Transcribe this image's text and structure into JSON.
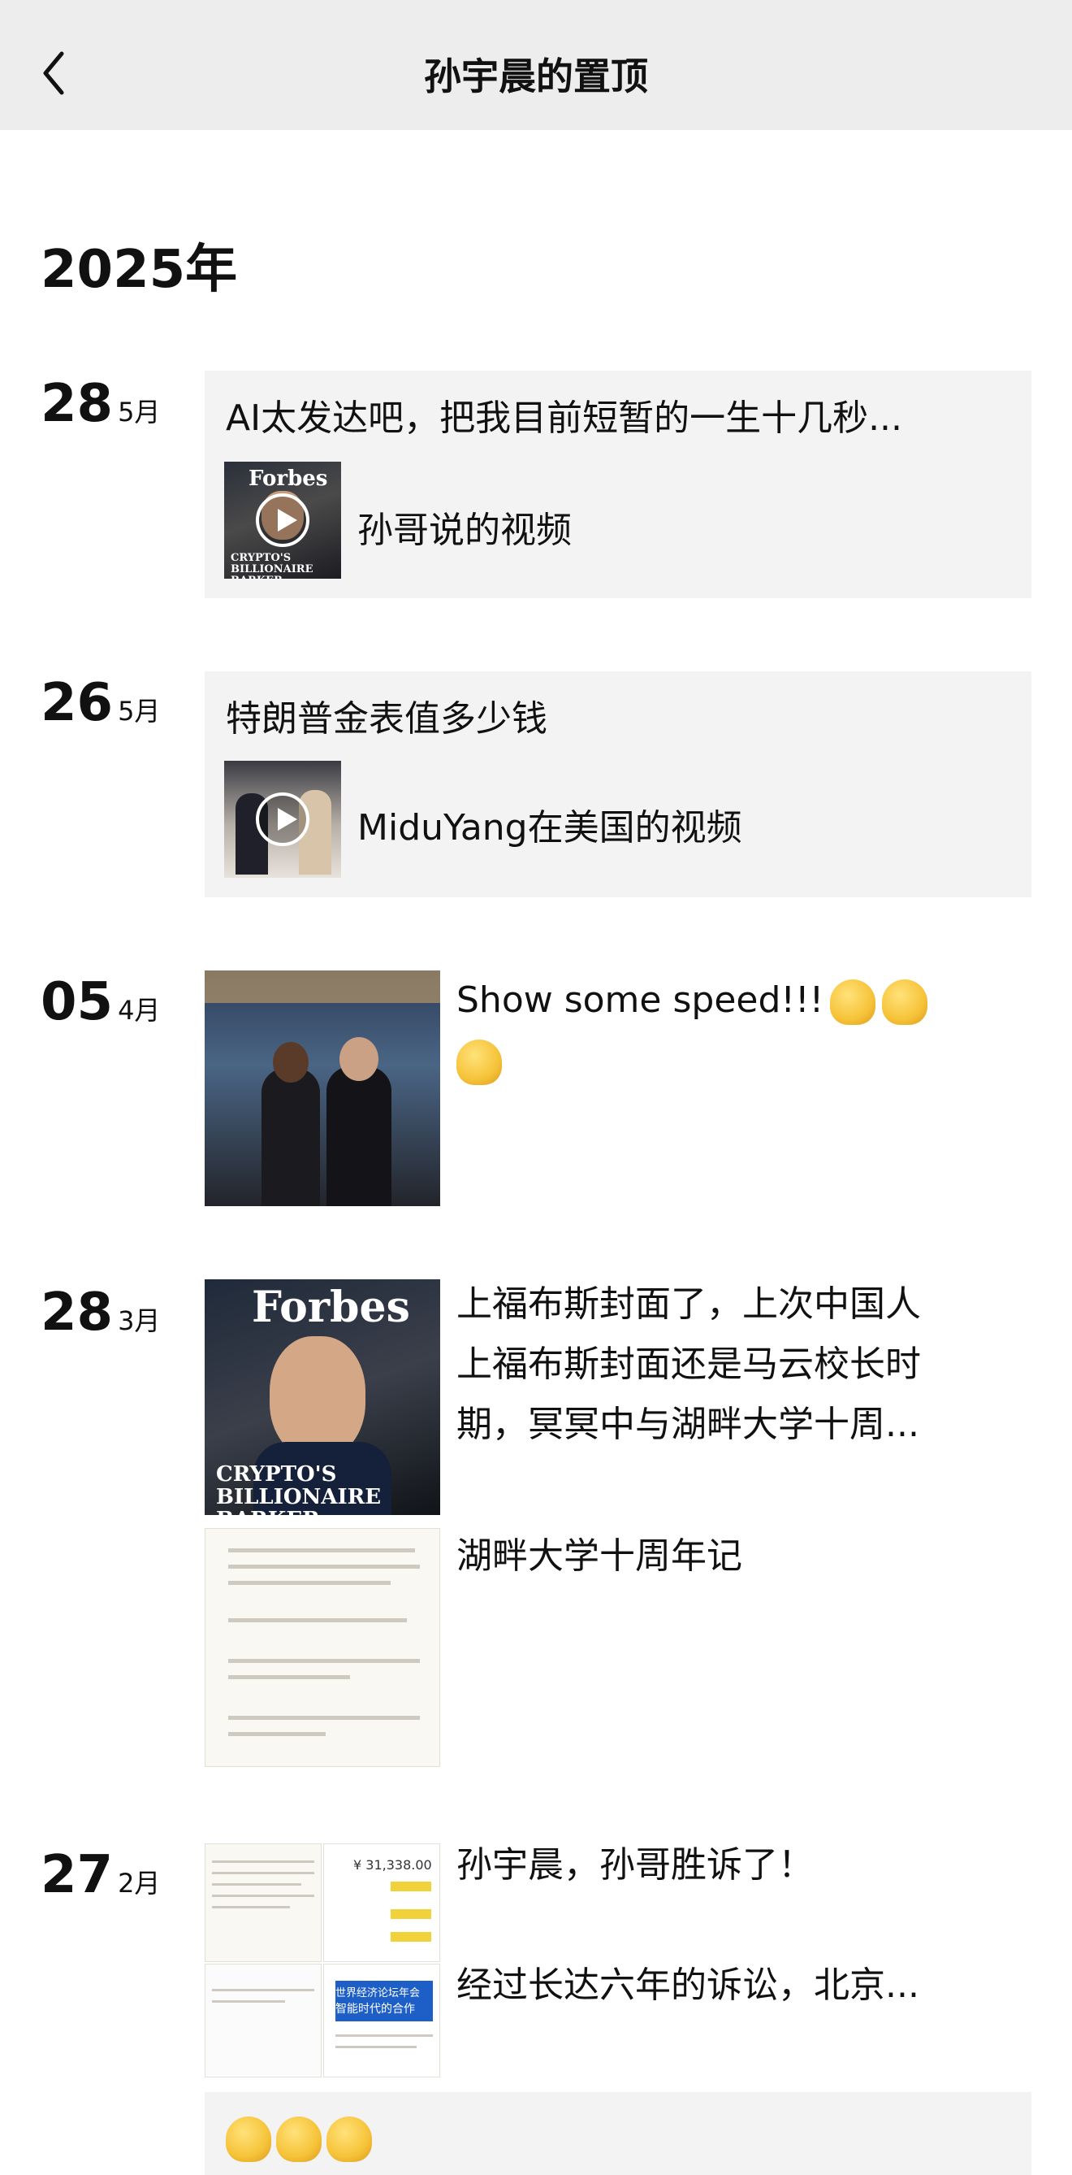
{
  "header": {
    "title": "孙宇晨的置顶"
  },
  "year": "2025年",
  "posts": [
    {
      "day": "28",
      "month": "5月",
      "title": "AI太发达吧，把我目前短暂的一生十几秒...",
      "video_label": "孙哥说的视频",
      "thumb_text": "Forbes",
      "thumb_sub": "CRYPTO'S BILLIONAIRE BARKER"
    },
    {
      "day": "26",
      "month": "5月",
      "title": "特朗普金表值多少钱",
      "video_label": "MiduYang在美国的视频"
    },
    {
      "day": "05",
      "month": "4月",
      "text": "Show some speed!!!"
    },
    {
      "day": "28",
      "month": "3月",
      "text_lines": [
        "上福布斯封面了，上次中国人",
        "上福布斯封面还是马云校长时",
        "期，冥冥中与湖畔大学十周..."
      ],
      "forbes_title": "Forbes",
      "forbes_sub": "CRYPTO'S BILLIONAIRE BARKER",
      "link_title": "湖畔大学十周年记"
    },
    {
      "day": "27",
      "month": "2月",
      "text_lines": [
        "孙宇晨，孙哥胜诉了！",
        "",
        "经过长达六年的诉讼，北京..."
      ],
      "amount": "¥ 31,338.00",
      "news_banner": "世界经济论坛年会",
      "news_banner2": "智能时代的合作"
    }
  ]
}
